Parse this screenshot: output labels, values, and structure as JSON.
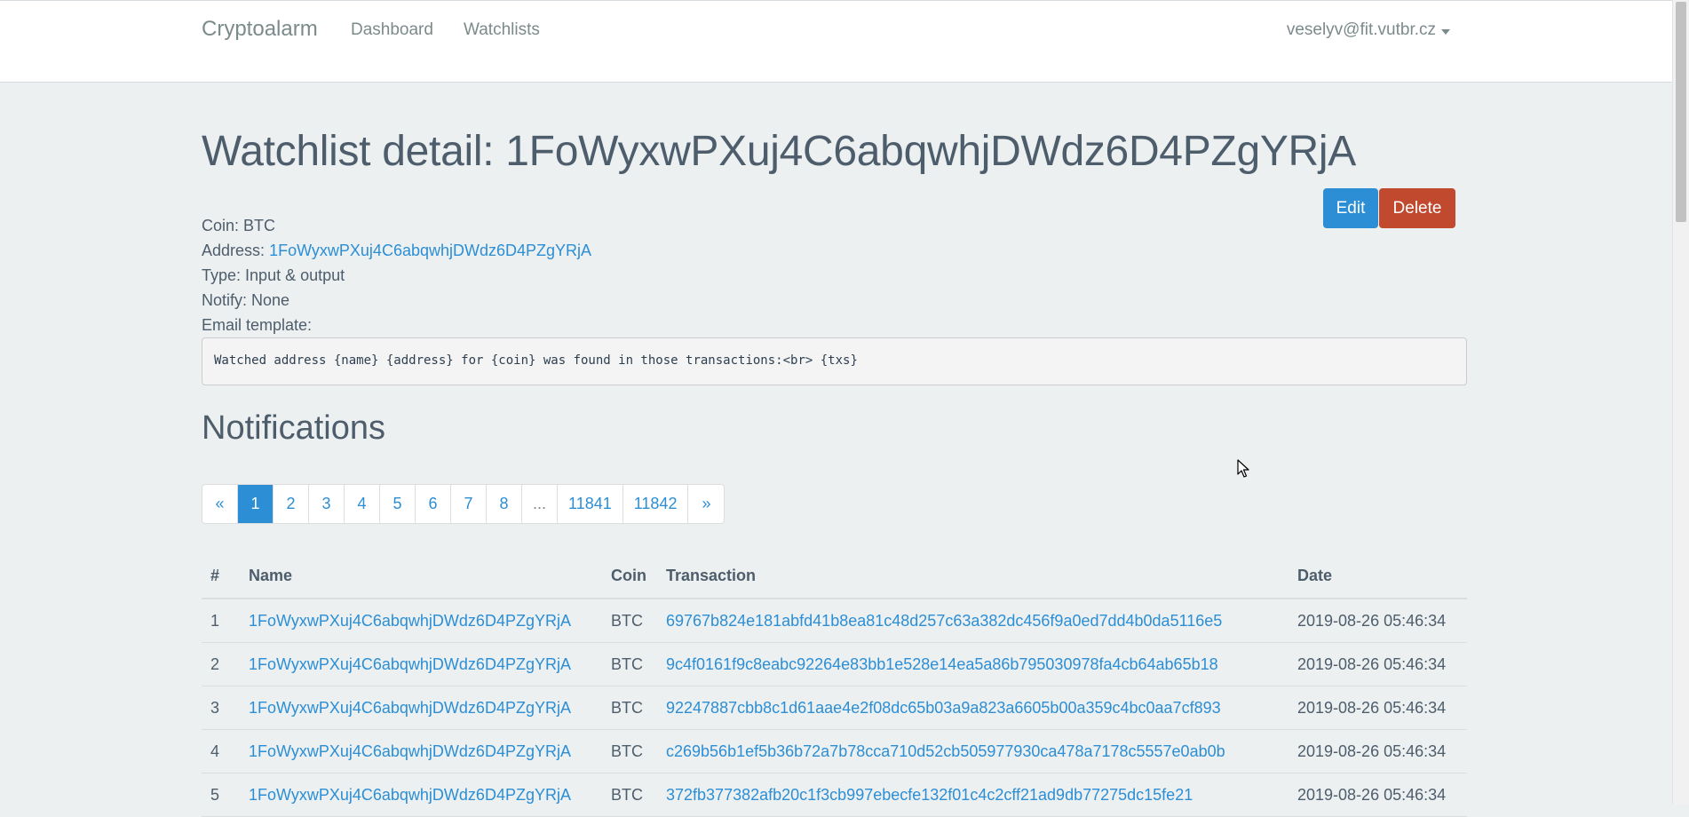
{
  "navbar": {
    "brand": "Cryptoalarm",
    "links": [
      "Dashboard",
      "Watchlists"
    ],
    "user": "veselyv@fit.vutbr.cz"
  },
  "page": {
    "title": "Watchlist detail: 1FoWyxwPXuj4C6abqwhjDWdz6D4PZgYRjA",
    "edit_label": "Edit",
    "delete_label": "Delete"
  },
  "details": {
    "coin_label": "Coin:",
    "coin_value": "BTC",
    "address_label": "Address:",
    "address_value": "1FoWyxwPXuj4C6abqwhjDWdz6D4PZgYRjA",
    "type_label": "Type:",
    "type_value": "Input & output",
    "notify_label": "Notify:",
    "notify_value": "None",
    "template_label": "Email template:",
    "template_value": "Watched address {name} {address} for {coin} was found in those transactions:<br> {txs}"
  },
  "notifications": {
    "title": "Notifications",
    "pagination": [
      "«",
      "1",
      "2",
      "3",
      "4",
      "5",
      "6",
      "7",
      "8",
      "...",
      "11841",
      "11842",
      "»"
    ],
    "active_page": "1",
    "columns": [
      "#",
      "Name",
      "Coin",
      "Transaction",
      "Date"
    ],
    "rows": [
      {
        "num": "1",
        "name": "1FoWyxwPXuj4C6abqwhjDWdz6D4PZgYRjA",
        "coin": "BTC",
        "tx": "69767b824e181abfd41b8ea81c48d257c63a382dc456f9a0ed7dd4b0da5116e5",
        "date": "2019-08-26 05:46:34"
      },
      {
        "num": "2",
        "name": "1FoWyxwPXuj4C6abqwhjDWdz6D4PZgYRjA",
        "coin": "BTC",
        "tx": "9c4f0161f9c8eabc92264e83bb1e528e14ea5a86b795030978fa4cb64ab65b18",
        "date": "2019-08-26 05:46:34"
      },
      {
        "num": "3",
        "name": "1FoWyxwPXuj4C6abqwhjDWdz6D4PZgYRjA",
        "coin": "BTC",
        "tx": "92247887cbb8c1d61aae4e2f08dc65b03a9a823a6605b00a359c4bc0aa7cf893",
        "date": "2019-08-26 05:46:34"
      },
      {
        "num": "4",
        "name": "1FoWyxwPXuj4C6abqwhjDWdz6D4PZgYRjA",
        "coin": "BTC",
        "tx": "c269b56b1ef5b36b72a7b78cca710d52cb505977930ca478a7178c5557e0ab0b",
        "date": "2019-08-26 05:46:34"
      },
      {
        "num": "5",
        "name": "1FoWyxwPXuj4C6abqwhjDWdz6D4PZgYRjA",
        "coin": "BTC",
        "tx": "372fb377382afb20c1f3cb997ebecfe132f01c4c2cff21ad9db77275dc15fe21",
        "date": "2019-08-26 05:46:34"
      }
    ]
  },
  "icons": {
    "user_caret": "caret-down-icon",
    "cursor": "mouse-pointer-icon"
  },
  "colors": {
    "link": "#2c8ed4",
    "edit_button": "#2c8ed4",
    "delete_button": "#c0492e",
    "background": "#ecf0f1"
  }
}
